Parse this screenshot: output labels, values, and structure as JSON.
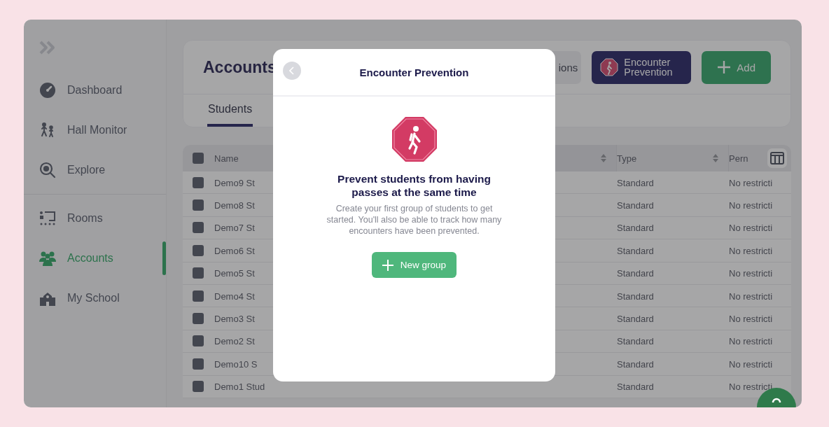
{
  "sidebar": {
    "groups": [
      {
        "items": [
          {
            "label": "Dashboard",
            "selected": false
          },
          {
            "label": "Hall Monitor",
            "selected": false
          },
          {
            "label": "Explore",
            "selected": false
          }
        ]
      },
      {
        "items": [
          {
            "label": "Rooms",
            "selected": false
          },
          {
            "label": "Accounts",
            "selected": true
          },
          {
            "label": "My School",
            "selected": false
          }
        ]
      }
    ]
  },
  "header": {
    "title": "Accounts",
    "buttons": [
      {
        "label": "ions",
        "kind": "secondary"
      },
      {
        "label": "Encounter Prevention",
        "kind": "encounter"
      },
      {
        "label": "Add",
        "kind": "add"
      }
    ],
    "tabs": [
      {
        "label": "Students",
        "selected": true
      }
    ]
  },
  "table": {
    "columns": [
      {
        "label": "Name"
      },
      {
        "kind": "blank"
      },
      {
        "label": "Type"
      },
      {
        "label": "Pern"
      }
    ],
    "select_all_checked": false,
    "rows": [
      {
        "checked": false,
        "name": "Demo9 St",
        "type": "Standard",
        "column_4": "No restricti"
      },
      {
        "checked": false,
        "name": "Demo8 St",
        "type": "Standard",
        "column_4": "No restricti"
      },
      {
        "checked": false,
        "name": "Demo7 St",
        "type": "Standard",
        "column_4": "No restricti"
      },
      {
        "checked": false,
        "name": "Demo6 St",
        "type": "Standard",
        "column_4": "No restricti"
      },
      {
        "checked": false,
        "name": "Demo5 St",
        "type": "Standard",
        "column_4": "No restricti"
      },
      {
        "checked": false,
        "name": "Demo4 St",
        "type": "Standard",
        "column_4": "No restricti"
      },
      {
        "checked": false,
        "name": "Demo3 St",
        "type": "Standard",
        "column_4": "No restricti"
      },
      {
        "checked": false,
        "name": "Demo2 St",
        "type": "Standard",
        "column_4": "No restricti"
      },
      {
        "checked": false,
        "name": "Demo10 S",
        "type": "Standard",
        "column_4": "No restricti"
      },
      {
        "checked": false,
        "name": "Demo1 Stud",
        "type": "Standard",
        "column_4": "No restricti"
      }
    ]
  },
  "modal": {
    "title": "Encounter Prevention",
    "heading": "Prevent students from having passes at the same time",
    "body": "Create your first group of students to get started. You'll also be able to track how many encounters have been prevented.",
    "button": "New group"
  }
}
